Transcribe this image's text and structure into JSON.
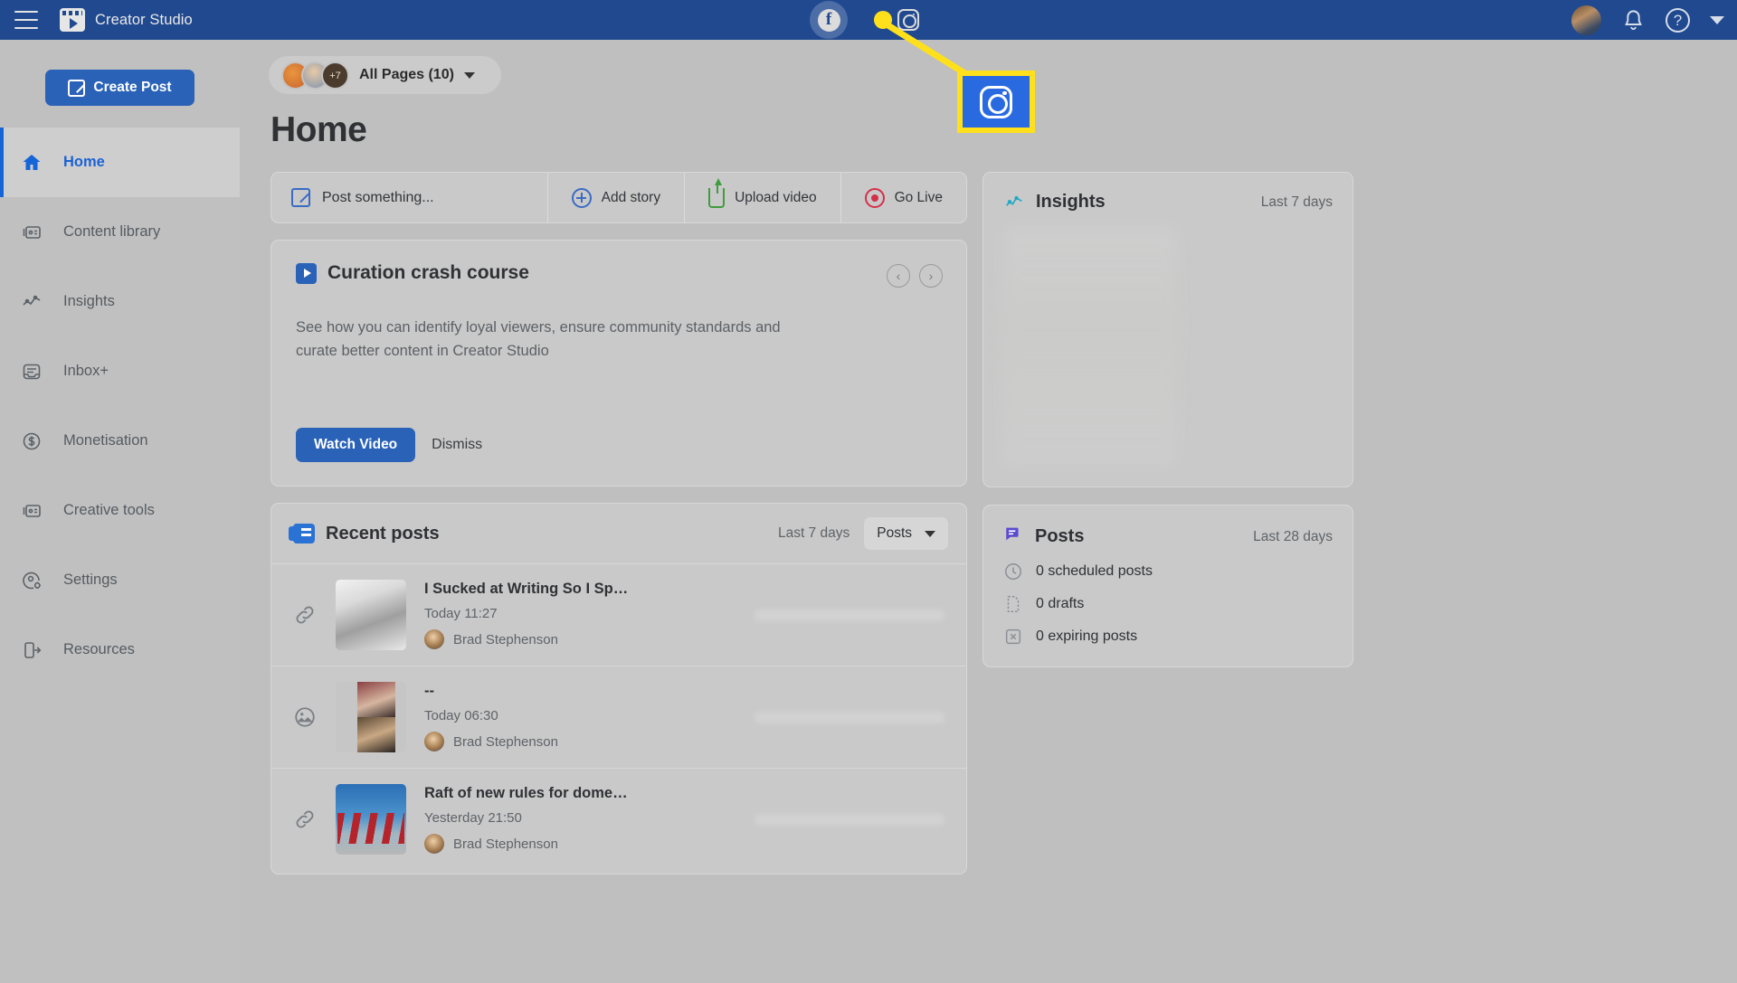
{
  "topbar": {
    "menu_icon": "hamburger-menu-icon",
    "brand": "Creator Studio",
    "brand_icon": "creator-studio-logo",
    "platform_switch": [
      {
        "name": "facebook",
        "label": "Facebook",
        "active": true
      },
      {
        "name": "instagram",
        "label": "Instagram",
        "active": false
      }
    ],
    "avatar": "user-avatar",
    "bell_icon": "notifications-bell-icon",
    "help_icon": "help-question-icon",
    "caret_icon": "account-chevron-down-icon"
  },
  "sidebar": {
    "create_post": "Create Post",
    "items": [
      {
        "label": "Home",
        "icon": "home-icon",
        "active": true
      },
      {
        "label": "Content library",
        "icon": "content-library-icon",
        "active": false
      },
      {
        "label": "Insights",
        "icon": "insights-chart-icon",
        "active": false
      },
      {
        "label": "Inbox+",
        "icon": "inbox-icon",
        "active": false
      },
      {
        "label": "Monetisation",
        "icon": "dollar-coin-icon",
        "active": false
      },
      {
        "label": "Creative tools",
        "icon": "creative-tools-icon",
        "active": false
      },
      {
        "label": "Settings",
        "icon": "settings-gear-icon",
        "active": false
      },
      {
        "label": "Resources",
        "icon": "resources-exit-icon",
        "active": false
      }
    ]
  },
  "header": {
    "pages_selector": "All Pages (10)",
    "pages_avatar_overflow": "+7",
    "page_title": "Home"
  },
  "composer": {
    "placeholder": "Post something...",
    "buttons": [
      {
        "label": "Add story",
        "icon": "plus-circle-icon"
      },
      {
        "label": "Upload video",
        "icon": "upload-arrow-icon"
      },
      {
        "label": "Go Live",
        "icon": "go-live-icon"
      }
    ]
  },
  "curation": {
    "title": "Curation crash course",
    "icon": "video-play-icon",
    "body": "See how you can identify loyal viewers, ensure community standards and curate better content in Creator Studio",
    "primary_button": "Watch Video",
    "secondary_button": "Dismiss",
    "prev_icon": "chevron-left-icon",
    "next_icon": "chevron-right-icon",
    "prev_glyph": "‹",
    "next_glyph": "›"
  },
  "recent_posts": {
    "title": "Recent posts",
    "icon": "recent-posts-icon",
    "period": "Last 7 days",
    "filter_value": "Posts",
    "rows": [
      {
        "type_icon": "link-icon",
        "title": "I Sucked at Writing So I Sp…",
        "time": "Today 11:27",
        "author": "Brad Stephenson",
        "thumb": "typewriter-photo"
      },
      {
        "type_icon": "photo-icon",
        "title": "--",
        "time": "Today 06:30",
        "author": "Brad Stephenson",
        "thumb": "news-interview-photo"
      },
      {
        "type_icon": "link-icon",
        "title": "Raft of new rules for dome…",
        "time": "Yesterday 21:50",
        "author": "Brad Stephenson",
        "thumb": "qantas-planes-photo"
      }
    ]
  },
  "insights": {
    "title": "Insights",
    "icon": "insights-chart-icon",
    "period": "Last 7 days"
  },
  "posts_panel": {
    "title": "Posts",
    "icon": "posts-bubble-icon",
    "period": "Last 28 days",
    "stats": [
      {
        "label": "0 scheduled posts",
        "icon": "clock-icon"
      },
      {
        "label": "0 drafts",
        "icon": "draft-document-icon"
      },
      {
        "label": "0 expiring posts",
        "icon": "expiring-box-icon"
      }
    ]
  },
  "annotation": {
    "target": "instagram",
    "callout_icon": "instagram-icon",
    "highlight_color": "#ffe01b",
    "tile_color": "#2a6ae0"
  }
}
